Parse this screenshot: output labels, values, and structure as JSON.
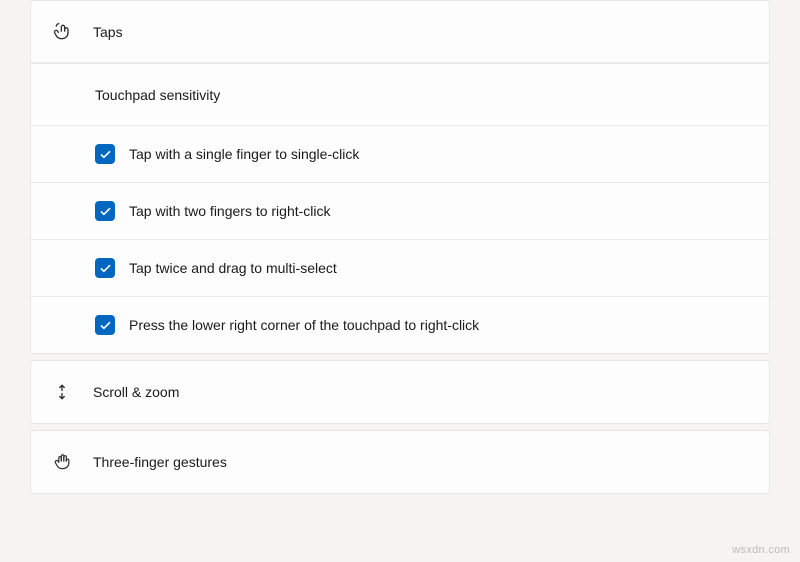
{
  "sections": {
    "taps": {
      "title": "Taps",
      "subheading": "Touchpad sensitivity",
      "options": [
        {
          "label": "Tap with a single finger to single-click",
          "checked": true
        },
        {
          "label": "Tap with two fingers to right-click",
          "checked": true
        },
        {
          "label": "Tap twice and drag to multi-select",
          "checked": true
        },
        {
          "label": "Press the lower right corner of the touchpad to right-click",
          "checked": true
        }
      ]
    },
    "scroll": {
      "title": "Scroll & zoom"
    },
    "three_finger": {
      "title": "Three-finger gestures"
    }
  },
  "watermark": "wsxdn.com"
}
